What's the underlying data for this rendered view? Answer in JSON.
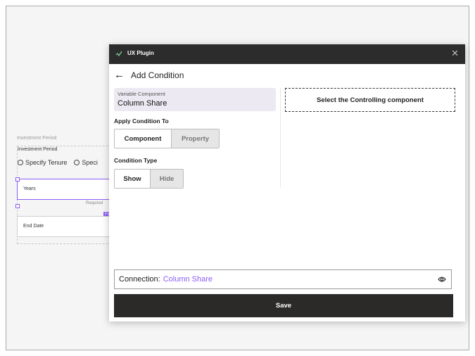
{
  "background_frame": {
    "outer_label": "Investment Period",
    "title": "Investment Period",
    "radio_options": [
      "Specify Tenure",
      "Speci"
    ],
    "years_label": "Years",
    "required_label": "Required",
    "fill_tag": "Fill",
    "end_date_label": "End Date"
  },
  "plugin": {
    "title": "UX Plugin",
    "close_icon": "✕",
    "back_icon": "←",
    "page_title": "Add Condition",
    "variable_component": {
      "label": "Variable Component",
      "value": "Column Share"
    },
    "apply_condition": {
      "label": "Apply Condition To",
      "options": [
        "Component",
        "Property"
      ],
      "selected": "Component"
    },
    "condition_type": {
      "label": "Condition Type",
      "options": [
        "Show",
        "Hide"
      ],
      "selected": "Show"
    },
    "controlling_prompt": "Select the Controlling component",
    "connection": {
      "label": "Connection:",
      "value": "Column Share"
    },
    "save_label": "Save"
  },
  "colors": {
    "accent": "#8a5cf6",
    "titlebar": "#2c2c2c",
    "save_button": "#2c2a28",
    "variable_card": "#ede9f2"
  }
}
